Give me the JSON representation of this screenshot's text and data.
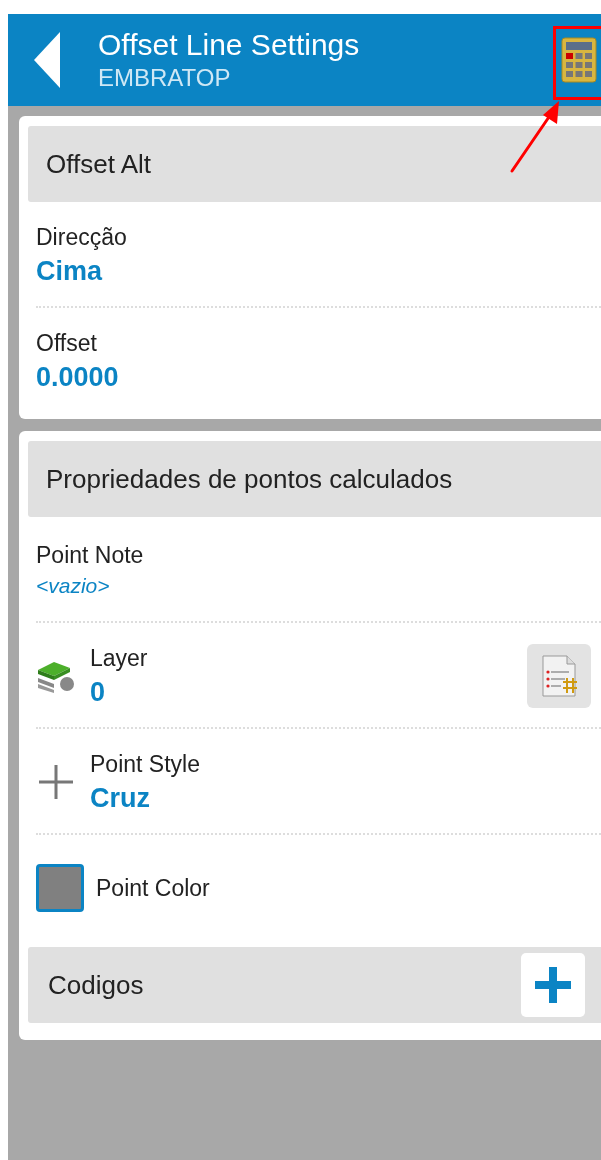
{
  "app_bar": {
    "title": "Offset Line Settings",
    "subtitle": "EMBRATOP",
    "annotation": {
      "highlighted": true
    }
  },
  "sections": [
    {
      "title": "Offset Alt",
      "fields": [
        {
          "kind": "text",
          "label": "Direcção",
          "value": "Cima",
          "empty": false
        },
        {
          "kind": "text",
          "label": "Offset",
          "value": "0.0000",
          "empty": false
        }
      ]
    },
    {
      "title": "Propriedades de pontos calculados",
      "fields": [
        {
          "kind": "text",
          "label": "Point Note",
          "value": "<vazio>",
          "empty": true
        },
        {
          "kind": "layer",
          "label": "Layer",
          "value": "0",
          "empty": false
        },
        {
          "kind": "style",
          "label": "Point Style",
          "value": "Cruz",
          "empty": false
        },
        {
          "kind": "color",
          "label": "Point Color",
          "color": "#808080"
        }
      ],
      "footer": {
        "title": "Codigos"
      }
    }
  ]
}
